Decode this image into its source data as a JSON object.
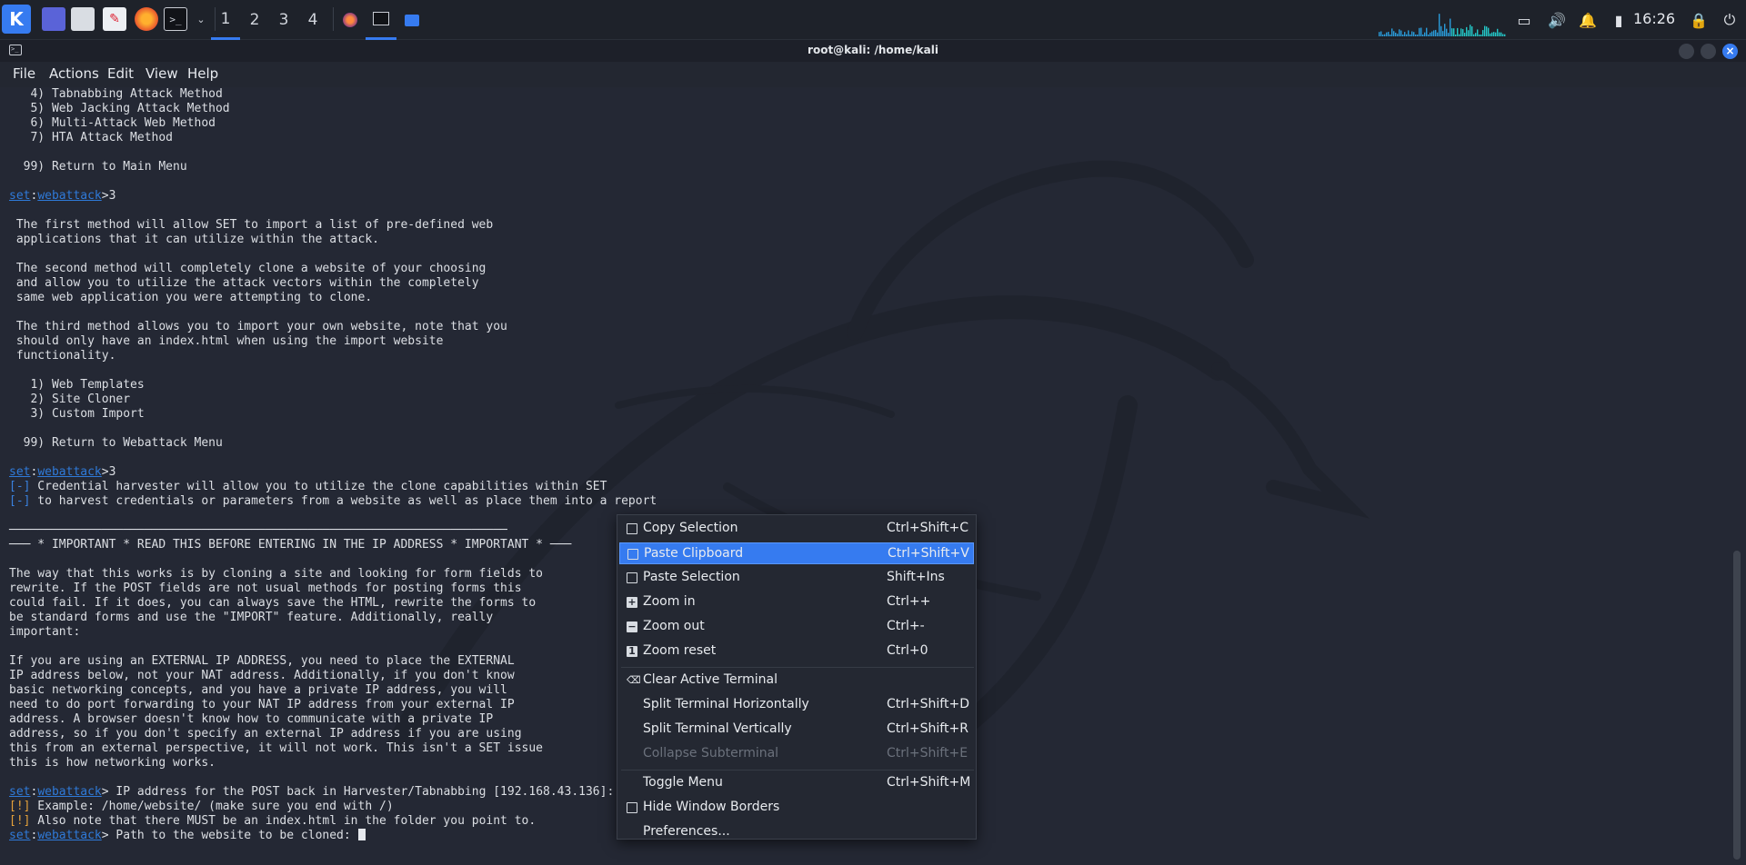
{
  "panel": {
    "workspaces": [
      "1",
      "2",
      "3",
      "4"
    ],
    "active_workspace": "1",
    "clock": "16:26",
    "app_icons": [
      "kali-menu-icon",
      "desktop-icon",
      "file-manager-icon",
      "text-editor-icon",
      "firefox-icon",
      "terminal-icon",
      "dropdown-icon"
    ],
    "tray_icons": [
      "display-icon",
      "volume-icon",
      "notification-bell-icon",
      "battery-icon",
      "lock-icon",
      "power-icon"
    ]
  },
  "window": {
    "title": "root@kali: /home/kali"
  },
  "menubar": {
    "file": "File",
    "actions": "Actions",
    "edit": "Edit",
    "view": "View",
    "help": "Help"
  },
  "terminal": {
    "lines": [
      [
        {
          "t": "   4) Tabnabbing Attack Method"
        }
      ],
      [
        {
          "t": "   5) Web Jacking Attack Method"
        }
      ],
      [
        {
          "t": "   6) Multi-Attack Web Method"
        }
      ],
      [
        {
          "t": "   7) HTA Attack Method"
        }
      ],
      [
        {
          "t": ""
        }
      ],
      [
        {
          "t": "  99) Return to Main Menu"
        }
      ],
      [
        {
          "t": ""
        }
      ],
      [
        {
          "t": "set",
          "c": "p-set"
        },
        {
          "t": ":"
        },
        {
          "t": "webattack",
          "c": "p-web"
        },
        {
          "t": ">3"
        }
      ],
      [
        {
          "t": ""
        }
      ],
      [
        {
          "t": " The first method will allow SET to import a list of pre-defined web"
        }
      ],
      [
        {
          "t": " applications that it can utilize within the attack."
        }
      ],
      [
        {
          "t": ""
        }
      ],
      [
        {
          "t": " The second method will completely clone a website of your choosing"
        }
      ],
      [
        {
          "t": " and allow you to utilize the attack vectors within the completely"
        }
      ],
      [
        {
          "t": " same web application you were attempting to clone."
        }
      ],
      [
        {
          "t": ""
        }
      ],
      [
        {
          "t": " The third method allows you to import your own website, note that you"
        }
      ],
      [
        {
          "t": " should only have an index.html when using the import website"
        }
      ],
      [
        {
          "t": " functionality."
        }
      ],
      [
        {
          "t": ""
        }
      ],
      [
        {
          "t": "   1) Web Templates"
        }
      ],
      [
        {
          "t": "   2) Site Cloner"
        }
      ],
      [
        {
          "t": "   3) Custom Import"
        }
      ],
      [
        {
          "t": ""
        }
      ],
      [
        {
          "t": "  99) Return to Webattack Menu"
        }
      ],
      [
        {
          "t": ""
        }
      ],
      [
        {
          "t": "set",
          "c": "p-set"
        },
        {
          "t": ":"
        },
        {
          "t": "webattack",
          "c": "p-web"
        },
        {
          "t": ">3"
        }
      ],
      [
        {
          "t": "[-]",
          "c": "p-blue"
        },
        {
          "t": " Credential harvester will allow you to utilize the clone capabilities within SET"
        }
      ],
      [
        {
          "t": "[-]",
          "c": "p-blue"
        },
        {
          "t": " to harvest credentials or parameters from a website as well as place them into a report"
        }
      ],
      [
        {
          "t": ""
        }
      ],
      [
        {
          "t": "──────────────────────────────────────────────────────────────────────"
        }
      ],
      [
        {
          "t": "─── * IMPORTANT * READ THIS BEFORE ENTERING IN THE IP ADDRESS * IMPORTANT * ───"
        }
      ],
      [
        {
          "t": ""
        }
      ],
      [
        {
          "t": "The way that this works is by cloning a site and looking for form fields to"
        }
      ],
      [
        {
          "t": "rewrite. If the POST fields are not usual methods for posting forms this"
        }
      ],
      [
        {
          "t": "could fail. If it does, you can always save the HTML, rewrite the forms to"
        }
      ],
      [
        {
          "t": "be standard forms and use the \"IMPORT\" feature. Additionally, really"
        }
      ],
      [
        {
          "t": "important:"
        }
      ],
      [
        {
          "t": ""
        }
      ],
      [
        {
          "t": "If you are using an EXTERNAL IP ADDRESS, you need to place the EXTERNAL"
        }
      ],
      [
        {
          "t": "IP address below, not your NAT address. Additionally, if you don't know"
        }
      ],
      [
        {
          "t": "basic networking concepts, and you have a private IP address, you will"
        }
      ],
      [
        {
          "t": "need to do port forwarding to your NAT IP address from your external IP"
        }
      ],
      [
        {
          "t": "address. A browser doesn't know how to communicate with a private IP"
        }
      ],
      [
        {
          "t": "address, so if you don't specify an external IP address if you are using"
        }
      ],
      [
        {
          "t": "this from an external perspective, it will not work. This isn't a SET issue"
        }
      ],
      [
        {
          "t": "this is how networking works."
        }
      ],
      [
        {
          "t": ""
        }
      ],
      [
        {
          "t": "set",
          "c": "p-set"
        },
        {
          "t": ":"
        },
        {
          "t": "webattack",
          "c": "p-web"
        },
        {
          "t": "> IP address for the POST back in Harvester/Tabnabbing [192.168.43.136]:"
        }
      ],
      [
        {
          "t": "[!]",
          "c": "p-warn"
        },
        {
          "t": " Example: /home/website/ (make sure you end with /)"
        }
      ],
      [
        {
          "t": "[!]",
          "c": "p-warn"
        },
        {
          "t": " Also note that there MUST be an index.html in the folder you point to."
        }
      ],
      [
        {
          "t": "set",
          "c": "p-set"
        },
        {
          "t": ":"
        },
        {
          "t": "webattack",
          "c": "p-web"
        },
        {
          "t": "> Path to the website to be cloned: "
        },
        {
          "cursor": true
        }
      ]
    ]
  },
  "context_menu": {
    "items": [
      {
        "label": "Copy Selection",
        "shortcut": "Ctrl+Shift+C",
        "icon": "copy-icon",
        "highlighted": false,
        "disabled": false
      },
      {
        "label": "Paste Clipboard",
        "shortcut": "Ctrl+Shift+V",
        "icon": "paste-icon",
        "highlighted": true,
        "disabled": false
      },
      {
        "label": "Paste Selection",
        "shortcut": "Shift+Ins",
        "icon": "paste-icon",
        "highlighted": false,
        "disabled": false
      },
      {
        "label": "Zoom in",
        "shortcut": "Ctrl++",
        "icon": "zoom-in-icon",
        "highlighted": false,
        "disabled": false
      },
      {
        "label": "Zoom out",
        "shortcut": "Ctrl+-",
        "icon": "zoom-out-icon",
        "highlighted": false,
        "disabled": false
      },
      {
        "label": "Zoom reset",
        "shortcut": "Ctrl+0",
        "icon": "zoom-reset-icon",
        "highlighted": false,
        "disabled": false
      },
      {
        "separator": true
      },
      {
        "label": "Clear Active Terminal",
        "shortcut": "",
        "icon": "clear-icon",
        "highlighted": false,
        "disabled": false
      },
      {
        "label": "Split Terminal Horizontally",
        "shortcut": "Ctrl+Shift+D",
        "icon": "",
        "highlighted": false,
        "disabled": false
      },
      {
        "label": "Split Terminal Vertically",
        "shortcut": "Ctrl+Shift+R",
        "icon": "",
        "highlighted": false,
        "disabled": false
      },
      {
        "label": "Collapse Subterminal",
        "shortcut": "Ctrl+Shift+E",
        "icon": "",
        "highlighted": false,
        "disabled": true
      },
      {
        "separator": true
      },
      {
        "label": "Toggle Menu",
        "shortcut": "Ctrl+Shift+M",
        "icon": "",
        "highlighted": false,
        "disabled": false
      },
      {
        "label": "Hide Window Borders",
        "shortcut": "",
        "icon": "checkbox-icon",
        "highlighted": false,
        "disabled": false
      },
      {
        "label": "Preferences...",
        "shortcut": "",
        "icon": "",
        "highlighted": false,
        "disabled": false
      }
    ]
  },
  "colors": {
    "accent": "#367bf0",
    "prompt": "#2f7ad9",
    "warning": "#e6a23a",
    "terminal_bg": "#242834"
  }
}
